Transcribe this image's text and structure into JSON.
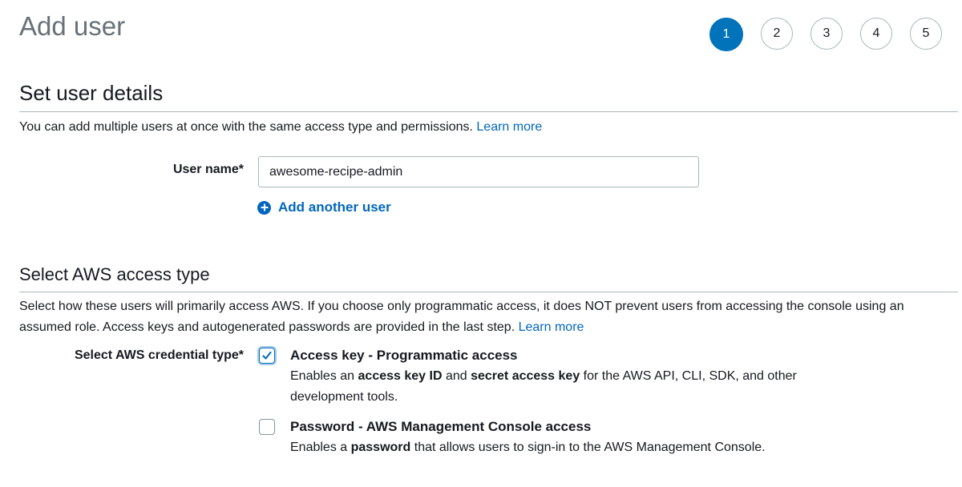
{
  "header": {
    "title": "Add user",
    "steps": [
      "1",
      "2",
      "3",
      "4",
      "5"
    ],
    "active_step": "1"
  },
  "details": {
    "title": "Set user details",
    "description": "You can add multiple users at once with the same access type and permissions.",
    "learn_more": "Learn more",
    "user_name_label": "User name*",
    "user_name_value": "awesome-recipe-admin",
    "add_another_user": "Add another user"
  },
  "access": {
    "title": "Select AWS access type",
    "description": "Select how these users will primarily access AWS. If you choose only programmatic access, it does NOT prevent users from accessing the console using an assumed role. Access keys and autogenerated passwords are provided in the last step.",
    "learn_more": "Learn more",
    "credential_label": "Select AWS credential type*",
    "options": [
      {
        "title": "Access key - Programmatic access",
        "checked": true,
        "desc_1": "Enables an ",
        "desc_2": "access key ID",
        "desc_3": " and ",
        "desc_4": "secret access key",
        "desc_5": " for the AWS API, CLI, SDK, and other development tools."
      },
      {
        "title": "Password - AWS Management Console access",
        "checked": false,
        "desc_1": "Enables a ",
        "desc_2": "password",
        "desc_3": " that allows users to sign-in to the AWS Management Console."
      }
    ]
  },
  "colors": {
    "accent": "#0073bb",
    "link": "#0066c0",
    "border": "#aab7b8",
    "title_gray": "#687078"
  },
  "icons": {
    "add_user": "plus-circle-icon",
    "checkmark": "checkmark-icon"
  }
}
